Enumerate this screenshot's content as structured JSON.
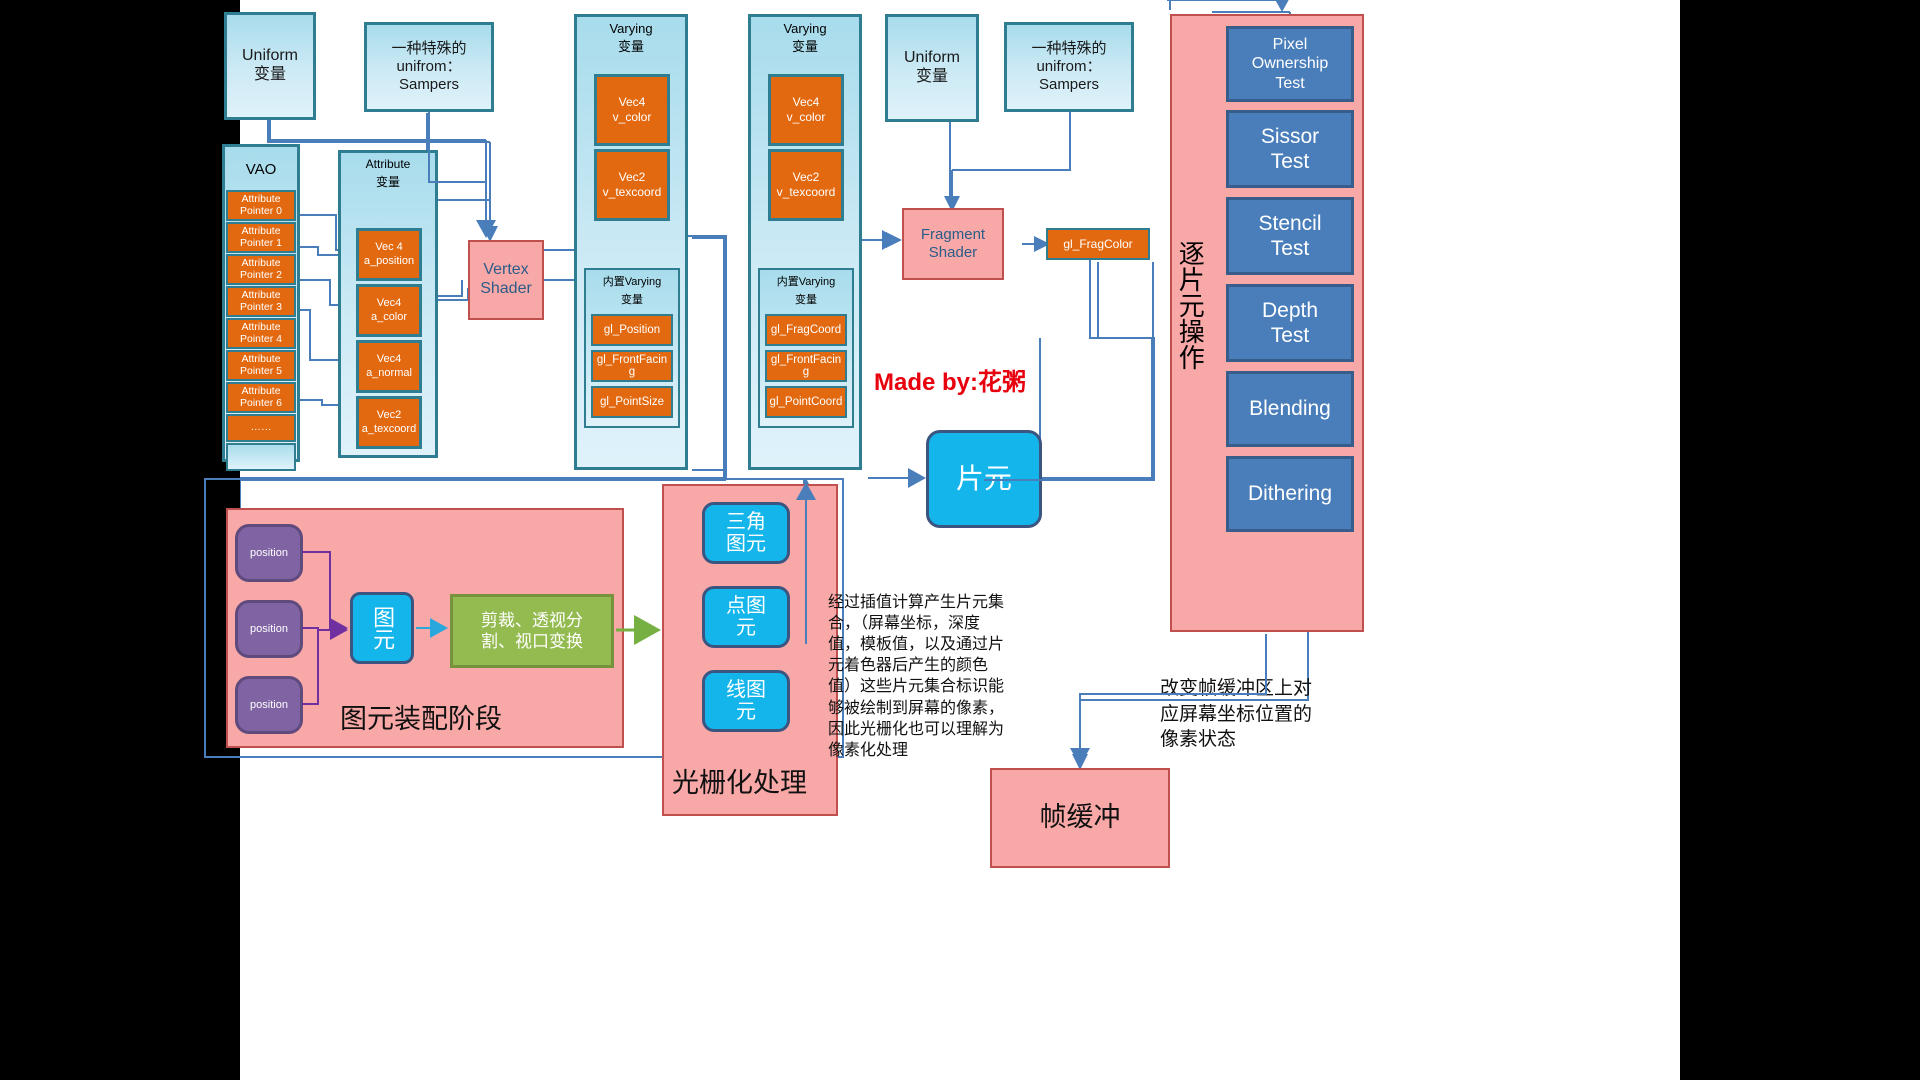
{
  "diagram": {
    "credit": "Made by:花粥",
    "top_row": {
      "uniform_left": "Uniform\n变量",
      "sampler_left": "一种特殊的\nunifrom：\nSampers",
      "varying_left_title": "Varying\n变量",
      "varying_right_title": "Varying\n变量",
      "uniform_right": "Uniform\n变量",
      "sampler_right": "一种特殊的\nunifrom：\nSampers"
    },
    "vao": {
      "title": "VAO",
      "pointers": [
        "Attribute\nPointer 0",
        "Attribute\nPointer 1",
        "Attribute\nPointer 2",
        "Attribute\nPointer 3",
        "Attribute\nPointer 4",
        "Attribute\nPointer 5",
        "Attribute\nPointer 6",
        "……"
      ]
    },
    "attribute_block": {
      "title": "Attribute\n变量",
      "items": [
        "Vec 4\na_position",
        "Vec4\na_color",
        "Vec4\na_normal",
        "Vec2\na_texcoord"
      ]
    },
    "vertex_shader": "Vertex\nShader",
    "fragment_shader": "Fragment\nShader",
    "gl_fragcolor": "gl_FragColor",
    "varying_left": {
      "title": "Varying\n变量",
      "items": [
        "Vec4\nv_color",
        "Vec2\nv_texcoord"
      ],
      "builtin_title": "内置Varying\n变量",
      "builtin_items": [
        "gl_Position",
        "gl_FrontFacing",
        "gl_PointSize"
      ]
    },
    "varying_right": {
      "title": "Varying\n变量",
      "items": [
        "Vec4\nv_color",
        "Vec2\nv_texcoord"
      ],
      "builtin_title": "内置Varying\n变量",
      "builtin_items": [
        "gl_FragCoord",
        "gl_FrontFacing",
        "gl_PointCoord"
      ]
    },
    "fragment_node": "片元",
    "per_fragment": {
      "label": "逐片元操作",
      "tests": [
        "Pixel\nOwnership\nTest",
        "Sissor\nTest",
        "Stencil\nTest",
        "Depth\nTest",
        "Blending",
        "Dithering"
      ]
    },
    "primitive_assembly": {
      "caption": "图元装配阶段",
      "positions": [
        "position",
        "position",
        "position"
      ],
      "primitive": "图元",
      "transform": "剪裁、透视分\n割、视口变换"
    },
    "rasterization": {
      "caption": "光栅化处理",
      "items": [
        "三角\n图元",
        "点图\n元",
        "线图\n元"
      ]
    },
    "raster_note": "经过插值计算产生片元集合，（屏幕坐标，深度值，模板值，以及通过片元着色器后产生的颜色值）这些片元集合标识能够被绘制到屏幕的像素，因此光栅化也可以理解为像素化处理",
    "framebuffer": {
      "label": "帧缓冲",
      "note": "改变帧缓冲区上对应屏幕坐标位置的像素状态"
    },
    "colors": {
      "orange": "#e2690f",
      "teal_border": "#2e7d91",
      "light_blue": "#cdeaf5",
      "pink": "#f9a8a8",
      "steel_blue": "#4a7ebb",
      "cyan": "#13b5ea",
      "purple": "#7f63a3",
      "green": "#94bb50",
      "red_text": "#e8000d"
    }
  }
}
